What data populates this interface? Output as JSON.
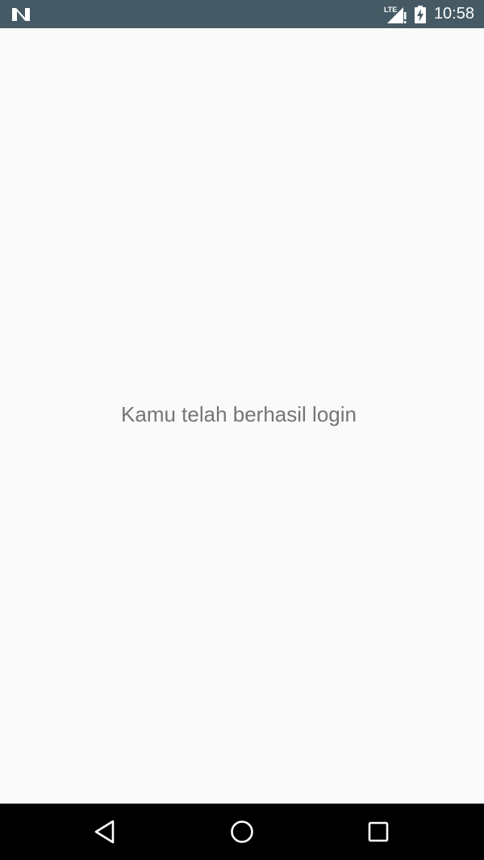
{
  "status_bar": {
    "network_label": "LTE",
    "time": "10:58",
    "icons": {
      "left": "n-notification-icon",
      "signal": "lte-signal-icon",
      "battery": "battery-charging-icon"
    },
    "background": "#455a64"
  },
  "main": {
    "message": "Kamu telah berhasil login"
  },
  "nav_bar": {
    "back": "back-icon",
    "home": "home-icon",
    "recents": "recents-icon"
  }
}
